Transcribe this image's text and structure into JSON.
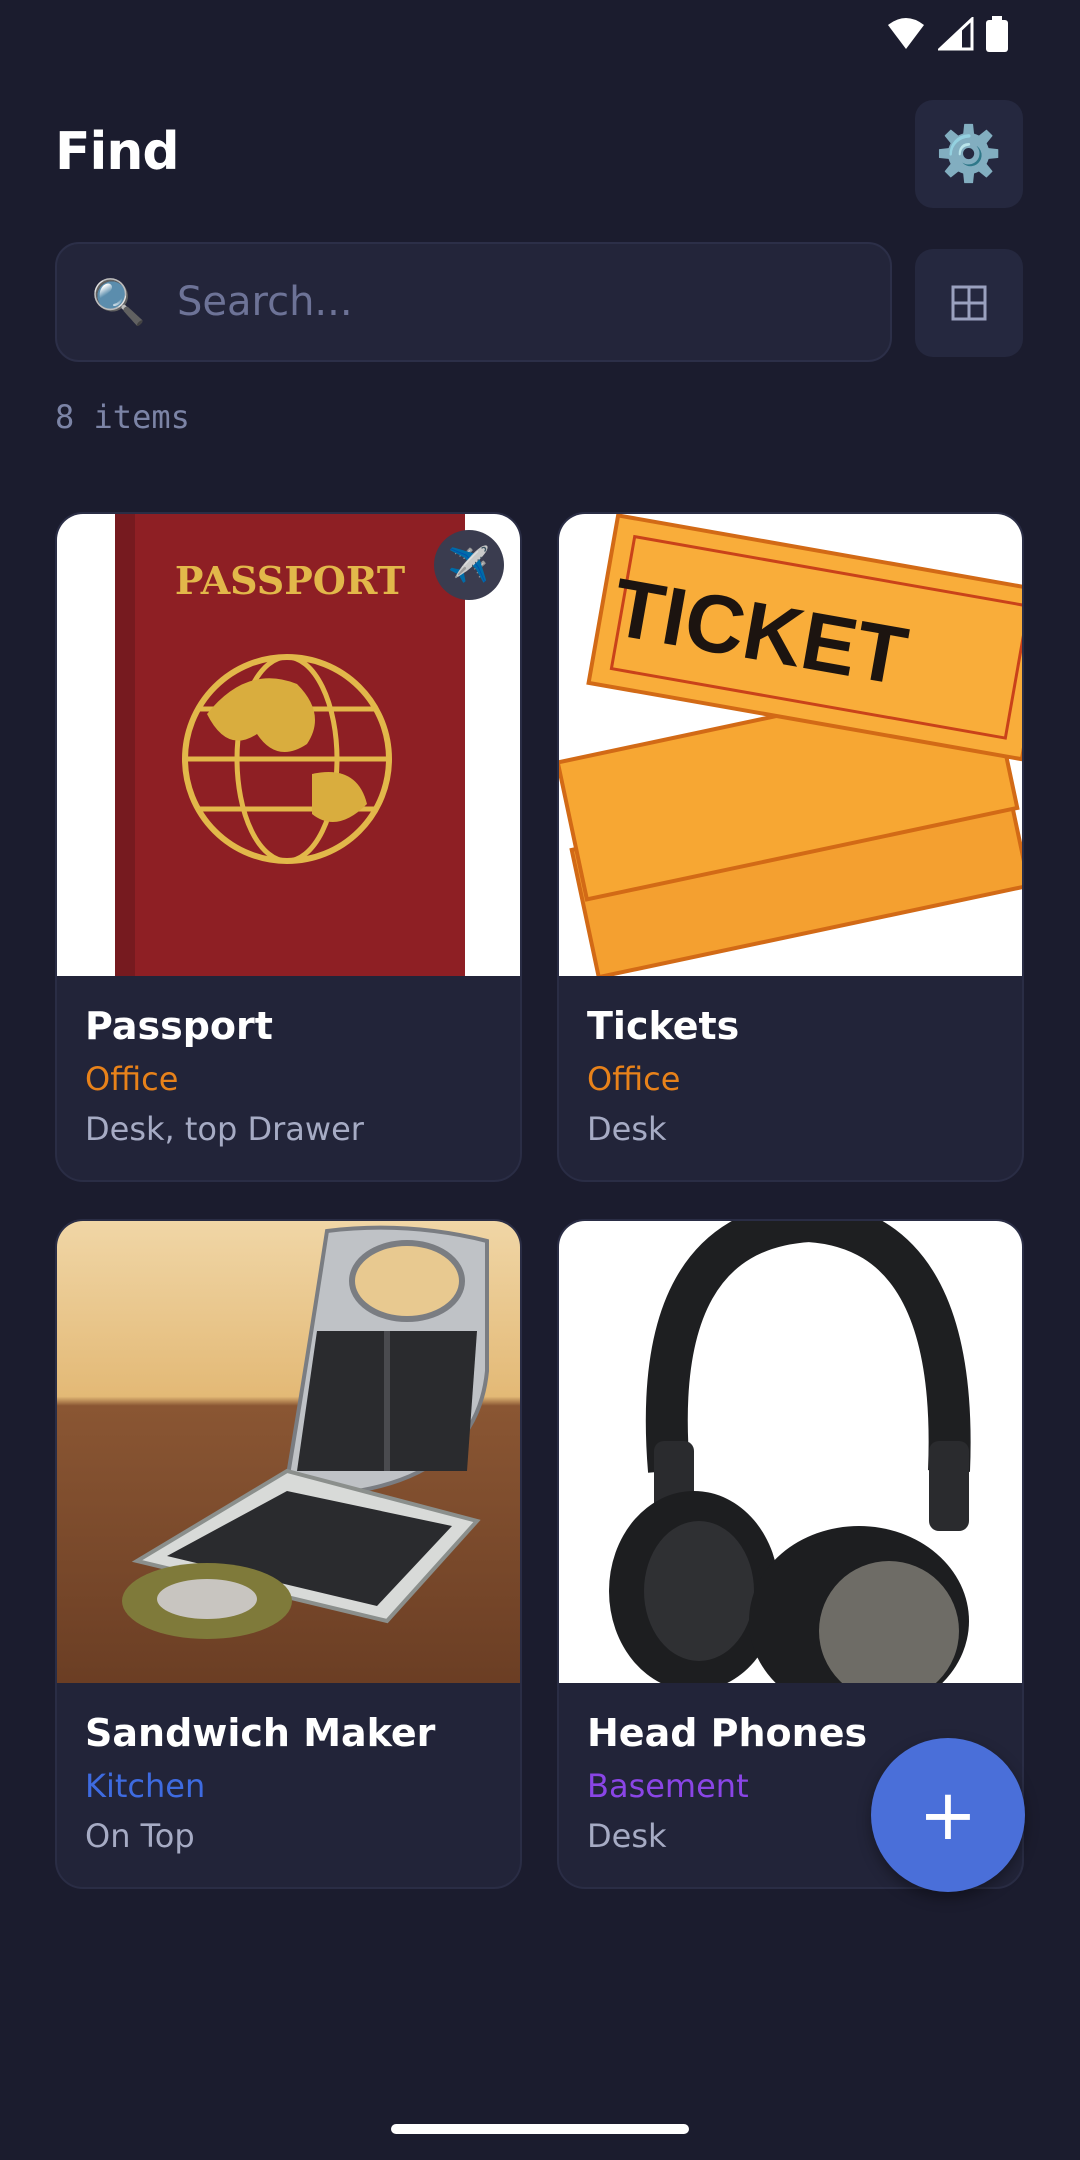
{
  "status_bar": {
    "icons": [
      "wifi-icon",
      "signal-icon",
      "battery-icon"
    ]
  },
  "header": {
    "title": "Find",
    "settings_icon": "gear-icon"
  },
  "search": {
    "placeholder": "Search...",
    "icon": "search-icon"
  },
  "view_toggle": {
    "icon": "grid-view-icon"
  },
  "item_count": "8 items",
  "items": [
    {
      "name": "Passport",
      "room": "Office",
      "room_color": "#e8821a",
      "spot": "Desk, top Drawer",
      "badge": "airplane-icon",
      "image": "passport"
    },
    {
      "name": "Tickets",
      "room": "Office",
      "room_color": "#e8821a",
      "spot": "Desk",
      "image": "tickets"
    },
    {
      "name": "Sandwich Maker",
      "room": "Kitchen",
      "room_color": "#3e6be0",
      "spot": "On Top",
      "image": "sandwich-maker"
    },
    {
      "name": "Head Phones",
      "room": "Basement",
      "room_color": "#8a45e6",
      "spot": "Desk",
      "image": "headphones"
    }
  ],
  "fab": {
    "label": "+"
  },
  "colors": {
    "background": "#1b1c2e",
    "card": "#222439",
    "accent": "#4a6fd9"
  }
}
